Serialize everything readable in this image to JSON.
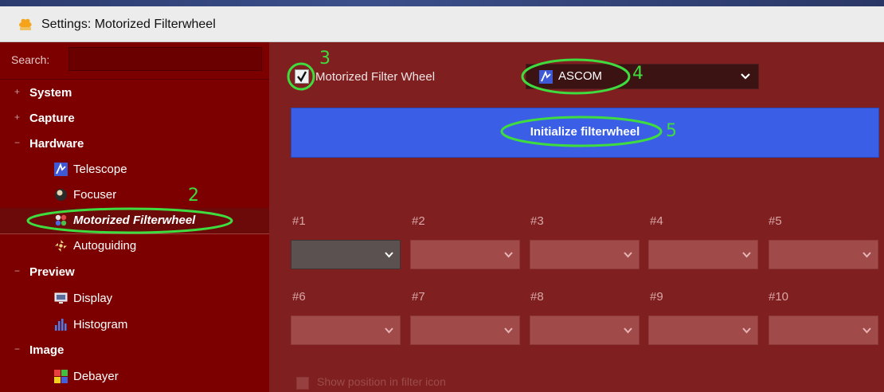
{
  "window": {
    "title": "Settings: Motorized Filterwheel"
  },
  "sidebar": {
    "search_label": "Search:",
    "search_value": "",
    "tree": [
      {
        "kind": "category",
        "expander": "+",
        "label": "System"
      },
      {
        "kind": "category",
        "expander": "+",
        "label": "Capture"
      },
      {
        "kind": "category",
        "expander": "−",
        "label": "Hardware"
      },
      {
        "kind": "child",
        "icon": "ascom-icon",
        "label": "Telescope"
      },
      {
        "kind": "child",
        "icon": "focuser-icon",
        "label": "Focuser"
      },
      {
        "kind": "child",
        "icon": "filterwheel-icon",
        "label": "Motorized Filterwheel",
        "selected": true
      },
      {
        "kind": "child",
        "icon": "autoguiding-icon",
        "label": "Autoguiding"
      },
      {
        "kind": "category",
        "expander": "−",
        "label": "Preview"
      },
      {
        "kind": "child",
        "icon": "display-icon",
        "label": "Display"
      },
      {
        "kind": "child",
        "icon": "histogram-icon",
        "label": "Histogram"
      },
      {
        "kind": "category",
        "expander": "−",
        "label": "Image"
      },
      {
        "kind": "child",
        "icon": "debayer-icon",
        "label": "Debayer"
      }
    ]
  },
  "main": {
    "enable_checkbox": {
      "label": "Motorized Filter Wheel",
      "checked": true
    },
    "driver_select": {
      "icon": "ascom-icon",
      "value": "ASCOM"
    },
    "init_button": {
      "label": "Initialize filterwheel"
    },
    "slots": [
      {
        "label": "#1",
        "value": ""
      },
      {
        "label": "#2",
        "value": ""
      },
      {
        "label": "#3",
        "value": ""
      },
      {
        "label": "#4",
        "value": ""
      },
      {
        "label": "#5",
        "value": ""
      },
      {
        "label": "#6",
        "value": ""
      },
      {
        "label": "#7",
        "value": ""
      },
      {
        "label": "#8",
        "value": ""
      },
      {
        "label": "#9",
        "value": ""
      },
      {
        "label": "#10",
        "value": ""
      }
    ],
    "show_position": {
      "label": "Show position in filter icon",
      "checked": false
    }
  },
  "annotations": [
    "2",
    "3",
    "4",
    "5"
  ],
  "colors": {
    "sidebar_bg": "#7c0000",
    "panel_bg": "#7f1f1f",
    "button_blue": "#3a5ee6",
    "annotation_green": "#3fdc3f"
  }
}
